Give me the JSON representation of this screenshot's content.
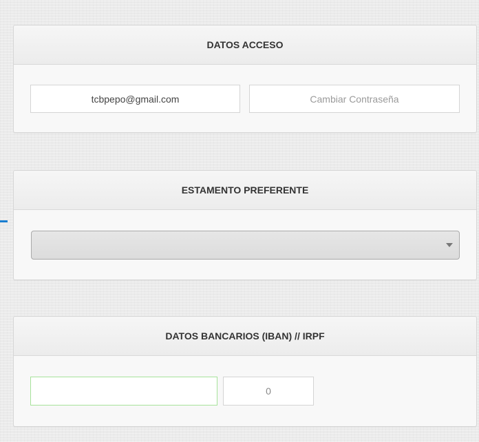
{
  "access": {
    "title": "DATOS ACCESO",
    "email": "tcbpepo@gmail.com",
    "change_password": "Cambiar Contraseña"
  },
  "estamento": {
    "title": "ESTAMENTO PREFERENTE",
    "selected": ""
  },
  "bank": {
    "title": "DATOS BANCARIOS (IBAN) // IRPF",
    "iban": "",
    "irpf": "0"
  },
  "colors": {
    "accent_marker": "#1a7fd1",
    "iban_border": "#a6e29a"
  }
}
